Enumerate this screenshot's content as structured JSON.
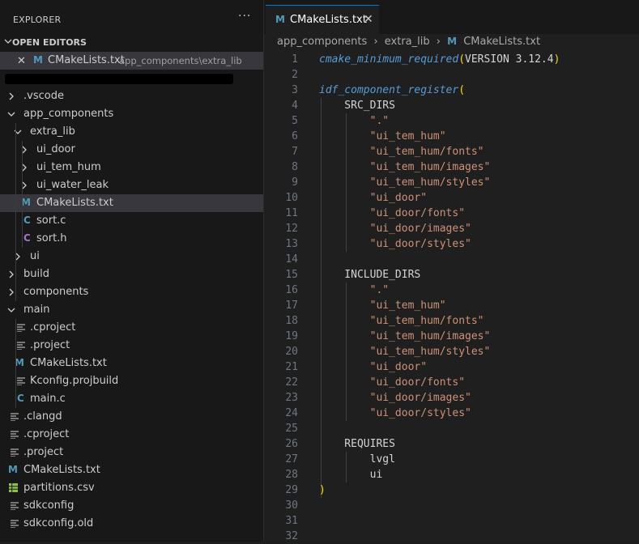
{
  "sidebar": {
    "title": "EXPLORER",
    "more_label": "···",
    "open_editors": {
      "title": "OPEN EDITORS",
      "items": [
        {
          "name": "CMakeLists.txt",
          "description": "app_components\\extra_lib",
          "icon": "M"
        }
      ]
    },
    "tree": {
      "root_label_redacted": true,
      "rows": [
        {
          "label": ".vscode",
          "kind": "folder",
          "expanded": false
        },
        {
          "label": "app_components",
          "kind": "folder",
          "expanded": true
        },
        {
          "label": "extra_lib",
          "kind": "folder",
          "expanded": true
        },
        {
          "label": "ui_door",
          "kind": "folder",
          "expanded": false
        },
        {
          "label": "ui_tem_hum",
          "kind": "folder",
          "expanded": false
        },
        {
          "label": "ui_water_leak",
          "kind": "folder",
          "expanded": false
        },
        {
          "label": "CMakeLists.txt",
          "kind": "cmake",
          "icon": "M",
          "selected": true
        },
        {
          "label": "sort.c",
          "kind": "c",
          "icon": "C"
        },
        {
          "label": "sort.h",
          "kind": "h",
          "icon": "C"
        },
        {
          "label": "ui",
          "kind": "folder",
          "expanded": false
        },
        {
          "label": "build",
          "kind": "folder",
          "expanded": false
        },
        {
          "label": "components",
          "kind": "folder",
          "expanded": false
        },
        {
          "label": "main",
          "kind": "folder",
          "expanded": true
        },
        {
          "label": ".cproject",
          "kind": "text"
        },
        {
          "label": ".project",
          "kind": "text"
        },
        {
          "label": "CMakeLists.txt",
          "kind": "cmake",
          "icon": "M"
        },
        {
          "label": "Kconfig.projbuild",
          "kind": "text"
        },
        {
          "label": "main.c",
          "kind": "c",
          "icon": "C"
        },
        {
          "label": ".clangd",
          "kind": "text"
        },
        {
          "label": ".cproject",
          "kind": "text"
        },
        {
          "label": ".project",
          "kind": "text"
        },
        {
          "label": "CMakeLists.txt",
          "kind": "cmake",
          "icon": "M"
        },
        {
          "label": "partitions.csv",
          "kind": "csv"
        },
        {
          "label": "sdkconfig",
          "kind": "text"
        },
        {
          "label": "sdkconfig.old",
          "kind": "text"
        }
      ]
    }
  },
  "editor": {
    "tab": {
      "label": "CMakeLists.txt",
      "icon": "M",
      "close": "✕"
    },
    "breadcrumb": [
      "app_components",
      "extra_lib",
      "CMakeLists.txt"
    ],
    "breadcrumb_sep": "›",
    "lines": [
      {
        "n": "1",
        "text": "cmake_minimum_required(VERSION 3.12.4)"
      },
      {
        "n": "2",
        "text": ""
      },
      {
        "n": "3",
        "text": "idf_component_register("
      },
      {
        "n": "4",
        "text": "    SRC_DIRS"
      },
      {
        "n": "5",
        "text": "        \".\""
      },
      {
        "n": "6",
        "text": "        \"ui_tem_hum\""
      },
      {
        "n": "7",
        "text": "        \"ui_tem_hum/fonts\""
      },
      {
        "n": "8",
        "text": "        \"ui_tem_hum/images\""
      },
      {
        "n": "9",
        "text": "        \"ui_tem_hum/styles\""
      },
      {
        "n": "10",
        "text": "        \"ui_door\""
      },
      {
        "n": "11",
        "text": "        \"ui_door/fonts\""
      },
      {
        "n": "12",
        "text": "        \"ui_door/images\""
      },
      {
        "n": "13",
        "text": "        \"ui_door/styles\""
      },
      {
        "n": "14",
        "text": ""
      },
      {
        "n": "15",
        "text": "    INCLUDE_DIRS"
      },
      {
        "n": "16",
        "text": "        \".\""
      },
      {
        "n": "17",
        "text": "        \"ui_tem_hum\""
      },
      {
        "n": "18",
        "text": "        \"ui_tem_hum/fonts\""
      },
      {
        "n": "19",
        "text": "        \"ui_tem_hum/images\""
      },
      {
        "n": "20",
        "text": "        \"ui_tem_hum/styles\""
      },
      {
        "n": "21",
        "text": "        \"ui_door\""
      },
      {
        "n": "22",
        "text": "        \"ui_door/fonts\""
      },
      {
        "n": "23",
        "text": "        \"ui_door/images\""
      },
      {
        "n": "24",
        "text": "        \"ui_door/styles\""
      },
      {
        "n": "25",
        "text": ""
      },
      {
        "n": "26",
        "text": "    REQUIRES"
      },
      {
        "n": "27",
        "text": "        lvgl"
      },
      {
        "n": "28",
        "text": "        ui"
      },
      {
        "n": "29",
        "text": ")"
      },
      {
        "n": "30",
        "text": ""
      },
      {
        "n": "31",
        "text": ""
      },
      {
        "n": "32",
        "text": ""
      }
    ]
  },
  "colors": {
    "cmake_icon": "#519aba",
    "c_icon": "#519aba",
    "h_icon": "#a074c4",
    "csv_icon": "#8dc149",
    "function": "#569cd6",
    "paren": "#ffd700",
    "string": "#ce9178",
    "text": "#d4d4d4"
  }
}
